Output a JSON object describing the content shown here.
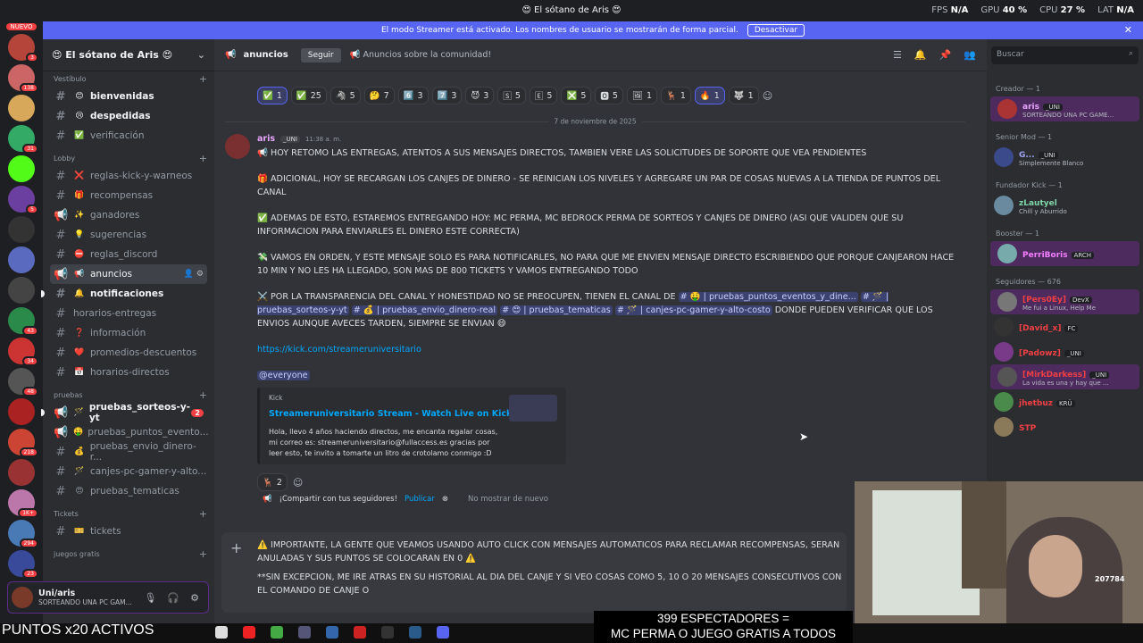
{
  "window": {
    "title": "😍 El sótano de Aris 😍",
    "stats": [
      {
        "k": "FPS",
        "v": "N/A"
      },
      {
        "k": "GPU",
        "v": "40 %"
      },
      {
        "k": "CPU",
        "v": "27 %"
      },
      {
        "k": "LAT",
        "v": "N/A"
      }
    ]
  },
  "banner": {
    "text": "El modo Streamer está activado. Los nombres de usuario se mostrarán de forma parcial.",
    "button": "Desactivar"
  },
  "server_rail": {
    "badges": [
      "3",
      "138",
      "31",
      "5",
      "43",
      "34",
      "48",
      "218",
      "1K+",
      "294",
      "23"
    ],
    "new_label": "NUEVO"
  },
  "server": {
    "name": "😍 El sótano de Aris 😍"
  },
  "categories": {
    "vestibulo": "Vestíbulo",
    "lobby": "Lobby",
    "pruebas": "pruebas",
    "tickets": "Tickets",
    "juegos": "juegos gratis"
  },
  "channels": {
    "c1": "bienvenidas",
    "c2": "despedidas",
    "c3": "verificación",
    "c4": "reglas-kick-y-warneos",
    "c5": "recompensas",
    "c6": "ganadores",
    "c7": "sugerencias",
    "c8": "reglas_discord",
    "c9": "anuncios",
    "c10": "notificaciones",
    "c11": "horarios-entregas",
    "c12": "información",
    "c13": "promedios-descuentos",
    "c14": "horarios-directos",
    "p1": "pruebas_sorteos-y-yt",
    "p1_count": "2",
    "p2": "pruebas_puntos_evento...",
    "p3": "pruebas_envio_dinero-r...",
    "p4": "canjes-pc-gamer-y-alto...",
    "p5": "pruebas_tematicas",
    "t1": "tickets"
  },
  "user": {
    "name": "Uni/aris",
    "status": "SORTEANDO UNA PC GAM..."
  },
  "header": {
    "channel": "anuncios",
    "follow": "Seguir",
    "topic": "📢 Anuncios sobre la comunidad!",
    "search_placeholder": "Buscar"
  },
  "reactions": [
    {
      "e": "✅",
      "c": "1",
      "me": true
    },
    {
      "e": "✅",
      "c": "25"
    },
    {
      "e": "🦓",
      "c": "5"
    },
    {
      "e": "🤔",
      "c": "7"
    },
    {
      "e": "6️⃣",
      "c": "3"
    },
    {
      "e": "7️⃣",
      "c": "3"
    },
    {
      "e": "😈",
      "c": "3"
    },
    {
      "e": "🅂",
      "c": "5"
    },
    {
      "e": "🄴",
      "c": "5"
    },
    {
      "e": "❎",
      "c": "5"
    },
    {
      "e": "🅾",
      "c": "5"
    },
    {
      "e": "🖼",
      "c": "1"
    },
    {
      "e": "🦌",
      "c": "1"
    },
    {
      "e": "🔥",
      "c": "1",
      "me": true
    },
    {
      "e": "🐺",
      "c": "1"
    }
  ],
  "date_divider": "7 de noviembre de 2025",
  "message": {
    "author": "aris",
    "tag": "_UNI",
    "time": "11:38 a. m.",
    "p1": "📢 HOY RETOMO LAS ENTREGAS, ATENTOS A SUS MENSAJES DIRECTOS, TAMBIEN VERE LAS SOLICITUDES DE SOPORTE QUE VEA PENDIENTES",
    "p2": "🎁 ADICIONAL, HOY SE RECARGAN LOS CANJES DE DINERO - SE REINICIAN LOS NIVELES Y AGREGARE UN PAR DE COSAS NUEVAS A LA TIENDA DE PUNTOS DEL CANAL",
    "p3": "✅ ADEMAS DE ESTO, ESTAREMOS ENTREGANDO HOY: MC PERMA, MC BEDROCK PERMA DE SORTEOS Y CANJES DE DINERO (ASI QUE VALIDEN QUE SU INFORMACION PARA ENVIARLES EL DINERO ESTE CORRECTA)",
    "p4": "💸 VAMOS EN ORDEN, Y ESTE MENSAJE SOLO ES PARA NOTIFICARLES, NO PARA QUE ME ENVIEN MENSAJE DIRECTO ESCRIBIENDO QUE PORQUE CANJEARON HACE 10 MIN Y NO LES HA LLEGADO, SON MAS DE 800 TICKETS Y VAMOS ENTREGANDO TODO",
    "p5a": "⚔️ POR LA TRANSPARENCIA DEL CANAL Y HONESTIDAD NO SE PREOCUPEN, TIENEN EL CANAL DE",
    "m1": "# 🤑 | pruebas_puntos_eventos_y_dine...",
    "m2": "# 🪄 | pruebas_sorteos-y-yt",
    "m3": "# 💰 | pruebas_envio_dinero-real",
    "m4": "# 😍 | pruebas_tematicas",
    "m5": "# 🪄 | canjes-pc-gamer-y-alto-costo",
    "p5b": "DONDE PUEDEN VERIFICAR QUE LOS ENVIOS AUNQUE AVECES TARDEN, SIEMPRE SE ENVIAN 😄",
    "url": "https://kick.com/streameruniversitario",
    "everyone": "@everyone",
    "embed": {
      "provider": "Kick",
      "title": "Streameruniversitario Stream - Watch Live on Kick",
      "desc": "Hola, llevo 4 años haciendo directos, me encanta regalar cosas, mi correo es: streameruniversitario@fullaccess.es gracias por leer esto, te invito a tomarte un litro de crotolamo conmigo :D"
    },
    "reaction": {
      "e": "🦌",
      "c": "2"
    }
  },
  "share": {
    "text": "¡Compartir con tus seguidores!",
    "publish": "Publicar",
    "no": "No mostrar de nuevo"
  },
  "composer": {
    "l1": "⚠️ IMPORTANTE, LA GENTE QUE VEAMOS USANDO AUTO CLICK CON MENSAJES AUTOMATICOS PARA RECLAMAR RECOMPENSAS, SERAN ANULADAS Y SUS PUNTOS SE COLOCARAN EN 0 ⚠️",
    "l2": "**SIN EXCEPCION, ME IRE ATRAS EN SU HISTORIAL AL DIA DEL CANJE Y SI VEO COSAS COMO 5, 10 O 20 MENSAJES CONSECUTIVOS CON EL COMANDO DE CANJE O"
  },
  "members": {
    "g1": "Creador — 1",
    "g2": "Senior Mod — 1",
    "g3": "Fundador Kick — 1",
    "g4": "Booster — 1",
    "g5": "Seguidores — 676",
    "list": [
      {
        "n": "aris",
        "s": "SORTEANDO UNA PC GAME...",
        "tag": "_UNI",
        "c": "#e8a5ff"
      },
      {
        "n": "G...",
        "s": "Simplemente Blanco",
        "tag": "_UNI",
        "c": "#a0a4f8"
      },
      {
        "n": "zLautyel",
        "s": "Chill y Aburrido",
        "tag": "",
        "c": "#7fd6a8"
      },
      {
        "n": "PerriBoris",
        "s": "",
        "tag": "ARCH",
        "c": "#f47fff"
      },
      {
        "n": "[Pers0Ey]",
        "s": "Me fui a Linux, Help Me",
        "tag": "DevX",
        "c": "#f23f43"
      },
      {
        "n": "[David_x]",
        "s": "",
        "tag": "FC",
        "c": "#f23f43"
      },
      {
        "n": "[Padowz]",
        "s": "",
        "tag": "_UNI",
        "c": "#f23f43"
      },
      {
        "n": "[MirkDarkess]",
        "s": "La vida es una y hay que ...",
        "tag": "_UNI",
        "c": "#f23f43"
      },
      {
        "n": "jhetbuz",
        "s": "",
        "tag": "KRÜ",
        "c": "#f23f43"
      },
      {
        "n": "STP",
        "s": "",
        "tag": "",
        "c": "#f23f43"
      }
    ]
  },
  "stream": {
    "puntos": "PUNTOS x20 ACTIVOS",
    "viewers": "399 ESPECTADORES =",
    "prize": "MC PERMA O JUEGO GRATIS A TODOS",
    "frog": "207784"
  },
  "colors": {
    "accent": "#5865f2",
    "link": "#00a8fc",
    "danger": "#f23f43"
  }
}
